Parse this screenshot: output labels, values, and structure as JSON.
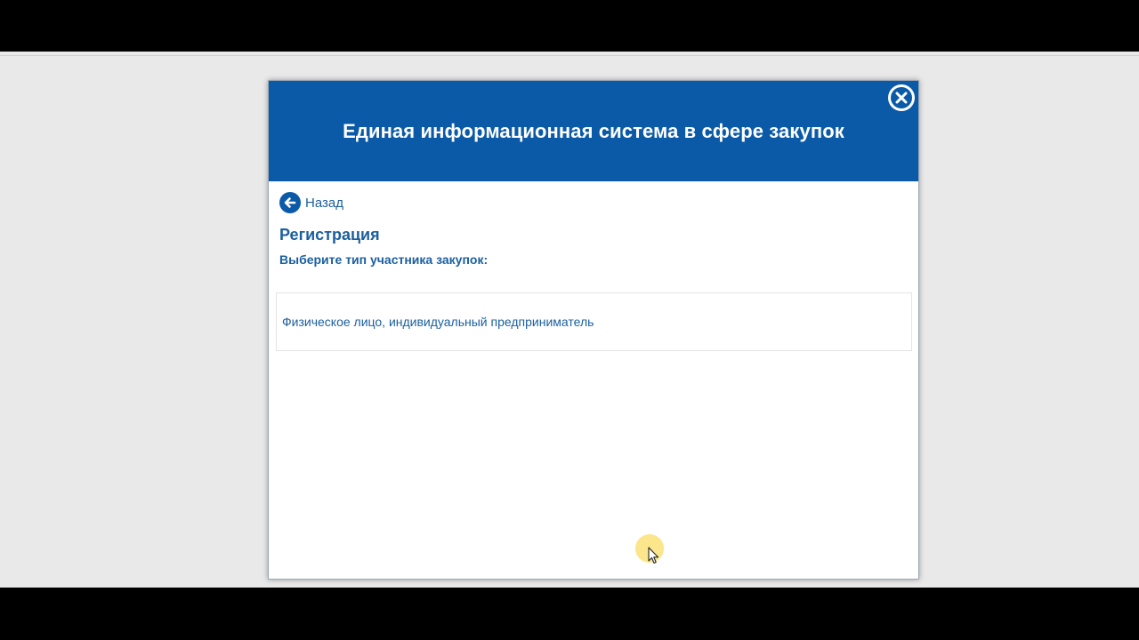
{
  "modal": {
    "title": "Единая информационная система в сфере закупок",
    "close_icon": "close-icon",
    "back": {
      "label": "Назад",
      "icon": "arrow-left-circle-icon"
    },
    "section_title": "Регистрация",
    "section_subtitle": "Выберите тип участника закупок:",
    "options": [
      {
        "label": "Физическое лицо, индивидуальный предприниматель"
      }
    ]
  },
  "colors": {
    "header_bg": "#0a5aa8",
    "link_text": "#1b5f9e",
    "page_bg": "#e9e9e9",
    "cursor_highlight": "#fadc5a"
  }
}
